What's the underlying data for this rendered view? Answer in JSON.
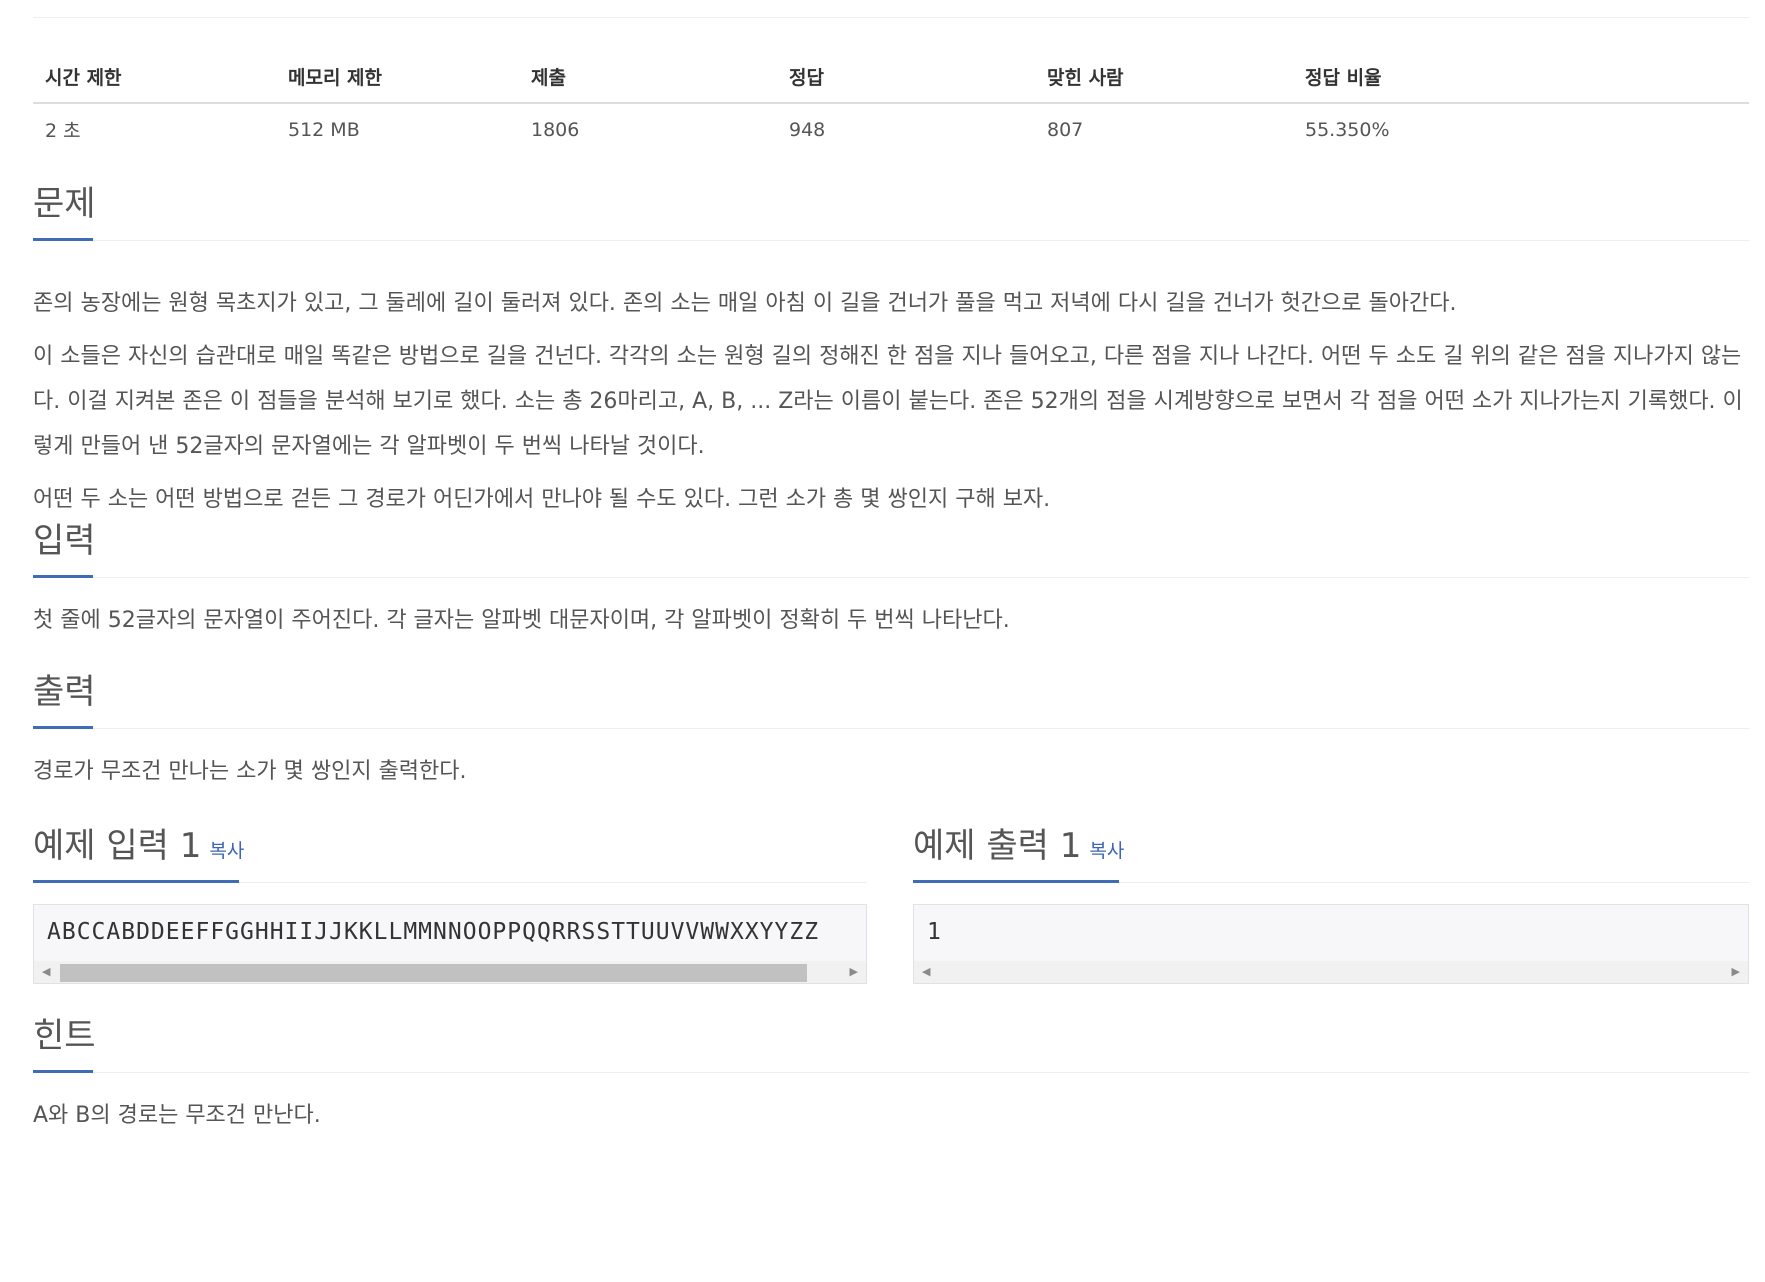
{
  "stats": {
    "headers": [
      "시간 제한",
      "메모리 제한",
      "제출",
      "정답",
      "맞힌 사람",
      "정답 비율"
    ],
    "values": [
      "2 초",
      "512 MB",
      "1806",
      "948",
      "807",
      "55.350%"
    ]
  },
  "problem": {
    "title": "문제",
    "paragraphs": [
      "존의 농장에는 원형 목초지가 있고, 그 둘레에 길이 둘러져 있다. 존의 소는 매일 아침 이 길을 건너가 풀을 먹고 저녁에 다시 길을 건너가 헛간으로 돌아간다.",
      "이 소들은 자신의 습관대로 매일 똑같은 방법으로 길을 건넌다. 각각의 소는 원형 길의 정해진 한 점을 지나 들어오고, 다른 점을 지나 나간다. 어떤 두 소도 길 위의 같은 점을 지나가지 않는다. 이걸 지켜본 존은 이 점들을 분석해 보기로 했다. 소는 총 26마리고, A, B, ... Z라는 이름이 붙는다. 존은 52개의 점을 시계방향으로 보면서 각 점을 어떤 소가 지나가는지 기록했다. 이렇게 만들어 낸 52글자의 문자열에는 각 알파벳이 두 번씩 나타날 것이다.",
      "어떤 두 소는 어떤 방법으로 걷든 그 경로가 어딘가에서 만나야 될 수도 있다. 그런 소가 총 몇 쌍인지 구해 보자."
    ]
  },
  "input": {
    "title": "입력",
    "text": "첫 줄에 52글자의 문자열이 주어진다. 각 글자는 알파벳 대문자이며, 각 알파벳이 정확히 두 번씩 나타난다."
  },
  "output": {
    "title": "출력",
    "text": "경로가 무조건 만나는 소가 몇 쌍인지 출력한다."
  },
  "sample_input": {
    "title": "예제 입력 1",
    "copy_label": "복사",
    "text": "ABCCABDDEEFFGGHHIIJJKKLLMMNNOOPPQQRRSSTTUUVVWWXXYYZZ"
  },
  "sample_output": {
    "title": "예제 출력 1",
    "copy_label": "복사",
    "text": "1"
  },
  "hint": {
    "title": "힌트",
    "text": "A와 B의 경로는 무조건 만난다."
  }
}
